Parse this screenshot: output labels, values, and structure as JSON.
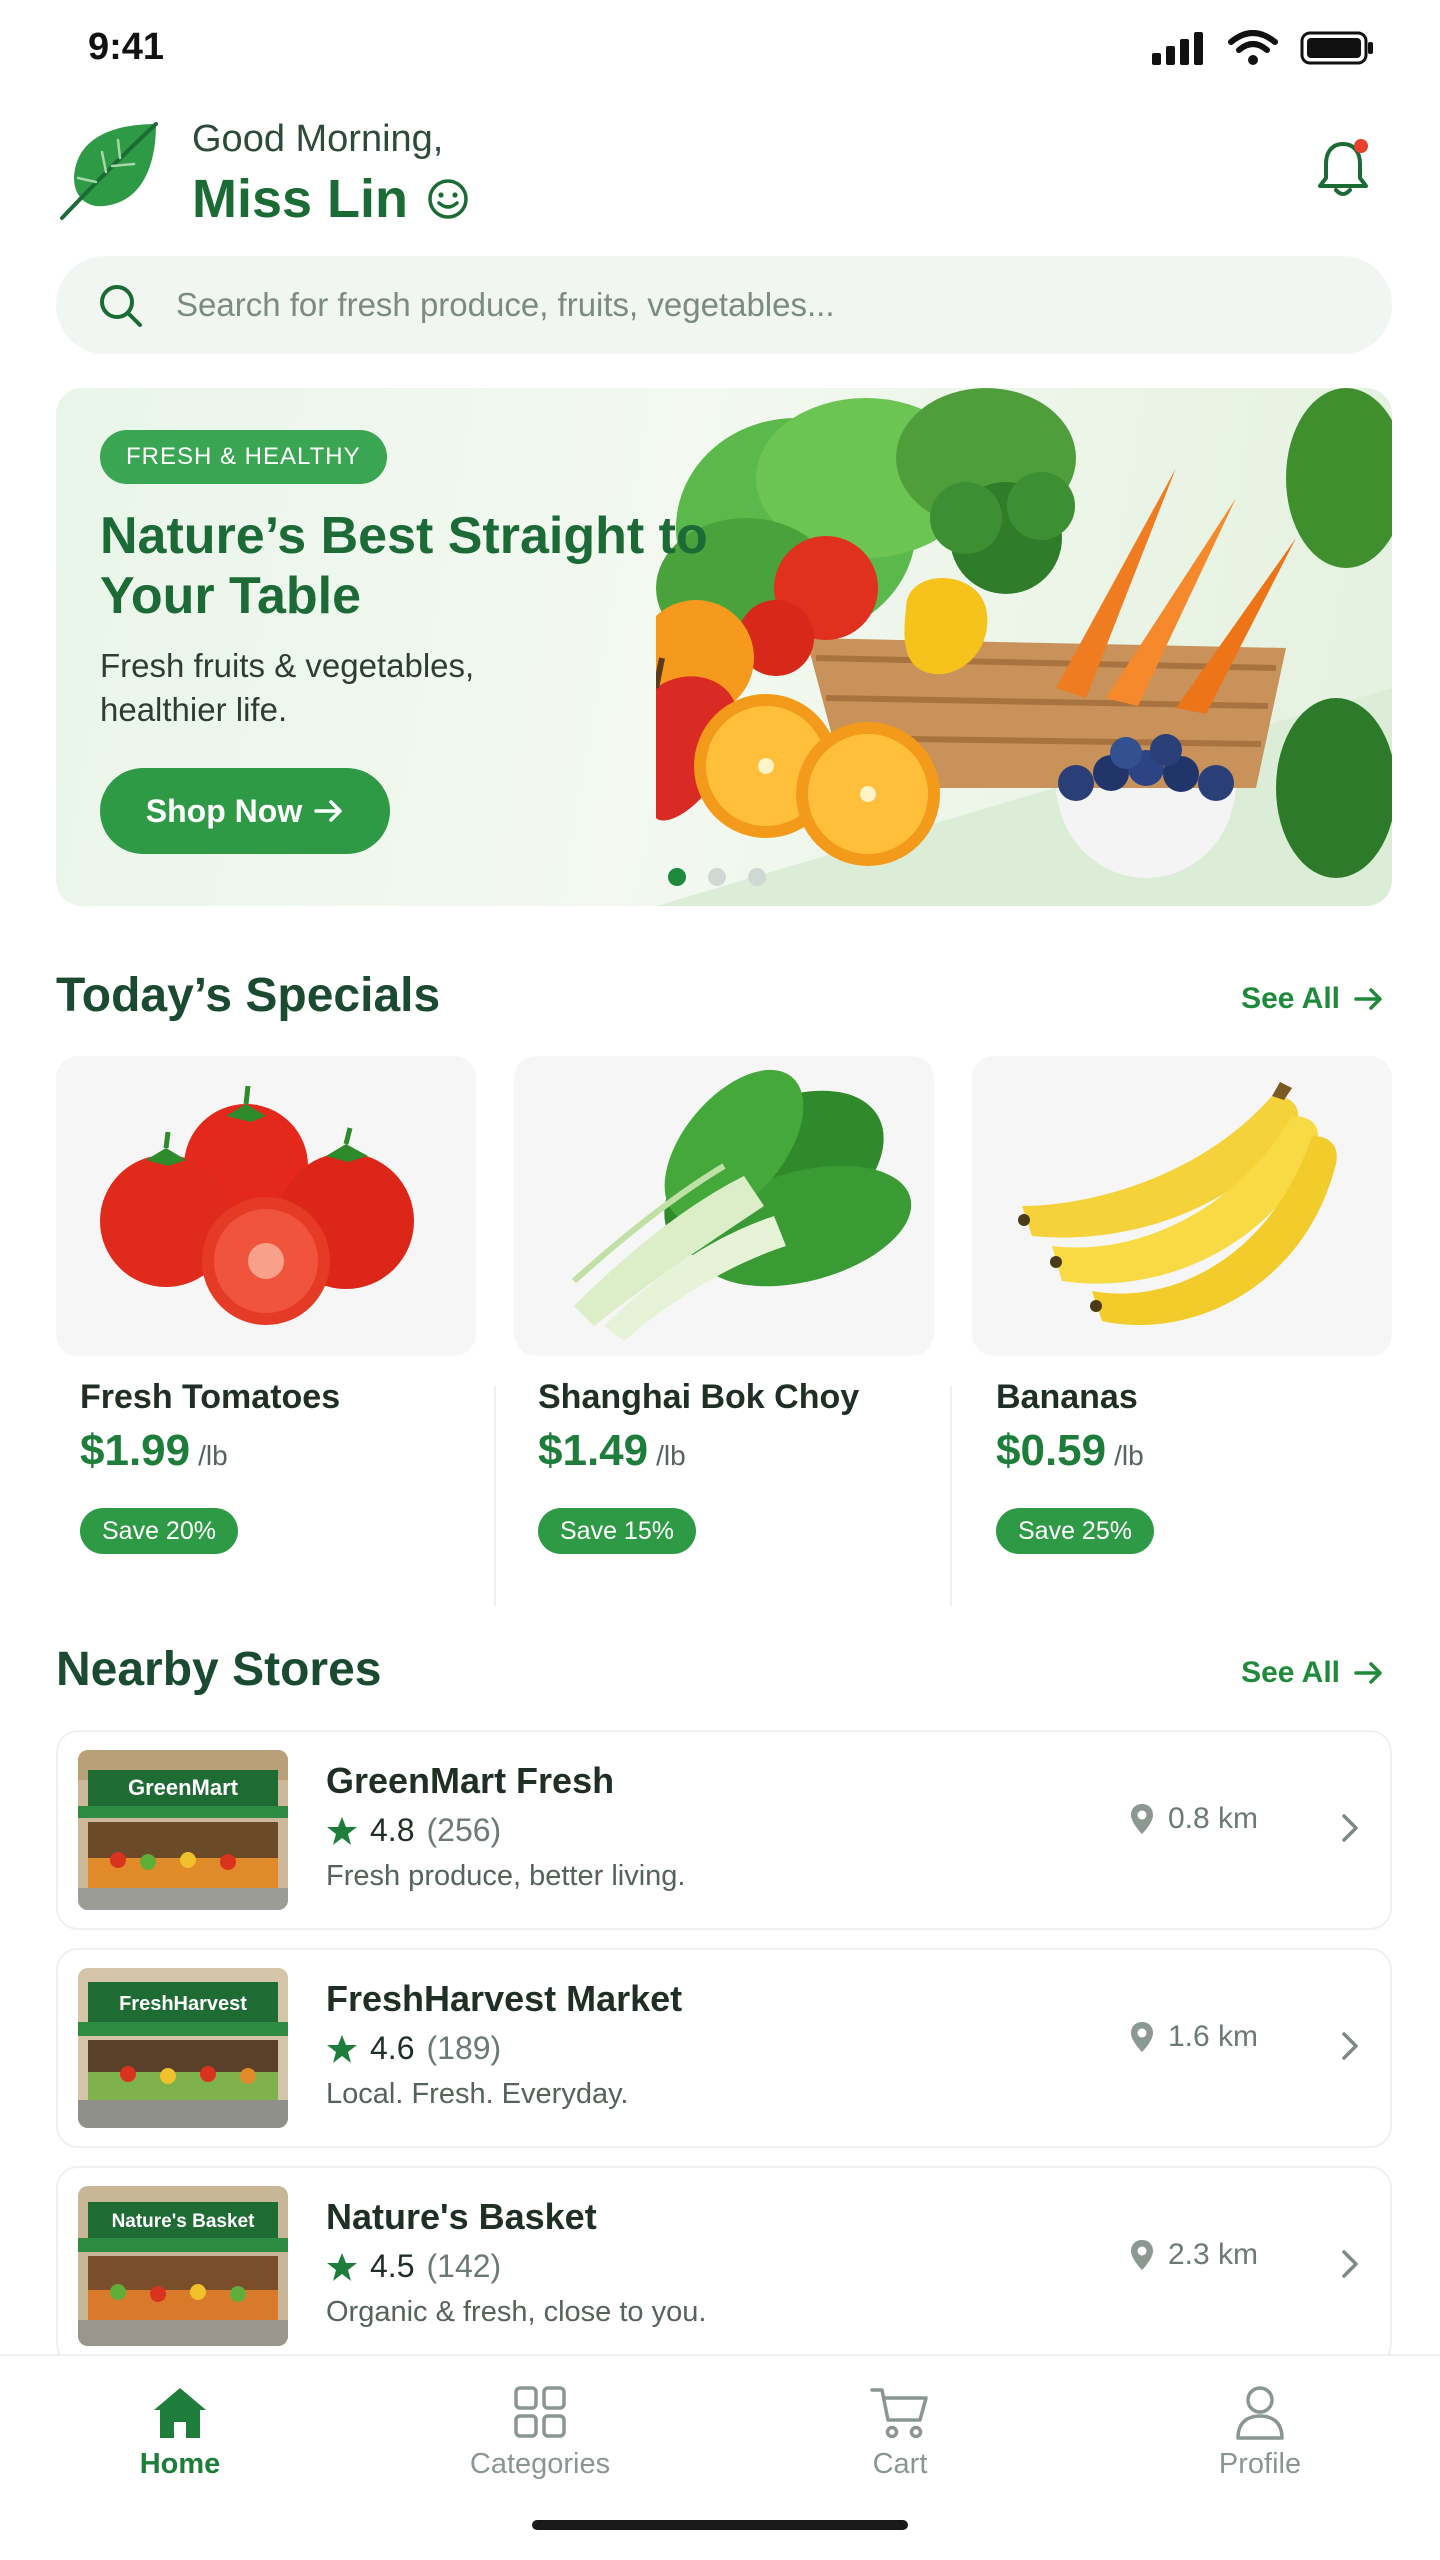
{
  "status_bar": {
    "time": "9:41"
  },
  "header": {
    "greeting": "Good Morning,",
    "username": "Miss Lin",
    "smile_icon": "smile-icon"
  },
  "search": {
    "placeholder": "Search for fresh produce, fruits, vegetables..."
  },
  "banner": {
    "tag": "FRESH & HEALTHY",
    "title": "Nature’s Best Straight to Your Table",
    "subtitle": "Fresh fruits & vegetables, healthier life.",
    "button": "Shop Now",
    "slides_total": 3,
    "active_slide": 1
  },
  "specials": {
    "title": "Today’s Specials",
    "see_all": "See All",
    "items": [
      {
        "name": "Fresh Tomatoes",
        "price": "$1.99",
        "unit": "/lb",
        "save": "Save 20%"
      },
      {
        "name": "Shanghai Bok Choy",
        "price": "$1.49",
        "unit": "/lb",
        "save": "Save 15%"
      },
      {
        "name": "Bananas",
        "price": "$0.59",
        "unit": "/lb",
        "save": "Save 25%"
      }
    ]
  },
  "stores": {
    "title": "Nearby Stores",
    "see_all": "See All",
    "items": [
      {
        "sign": "GreenMart",
        "name": "GreenMart Fresh",
        "rating": "4.8",
        "reviews": "(256)",
        "desc": "Fresh produce, better living.",
        "distance": "0.8 km"
      },
      {
        "sign": "FreshHarvest",
        "name": "FreshHarvest Market",
        "rating": "4.6",
        "reviews": "(189)",
        "desc": "Local. Fresh. Everyday.",
        "distance": "1.6 km"
      },
      {
        "sign": "Nature's Basket",
        "name": "Nature's Basket",
        "rating": "4.5",
        "reviews": "(142)",
        "desc": "Organic & fresh, close to you.",
        "distance": "2.3 km"
      }
    ]
  },
  "nav": {
    "items": [
      {
        "label": "Home",
        "icon": "home-icon",
        "active": true
      },
      {
        "label": "Categories",
        "icon": "grid-icon",
        "active": false
      },
      {
        "label": "Cart",
        "icon": "cart-icon",
        "active": false
      },
      {
        "label": "Profile",
        "icon": "user-icon",
        "active": false
      }
    ]
  },
  "colors": {
    "brand": "#1e7d3a",
    "accent": "#2f9a46",
    "banner_bg": "#eaf5ea"
  }
}
